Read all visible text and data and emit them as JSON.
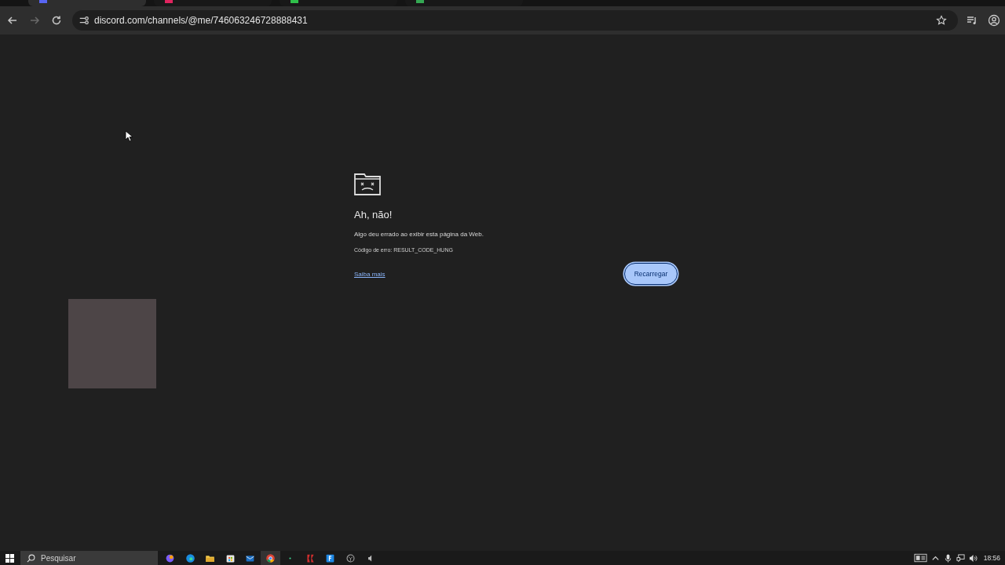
{
  "browser": {
    "tabs": [
      {
        "selected": true,
        "color": "#5865f2"
      },
      {
        "selected": false,
        "color": "#e0245e"
      },
      {
        "selected": false,
        "color": "#2fbf4a"
      },
      {
        "selected": false,
        "color": "#34a853"
      }
    ],
    "address": "discord.com/channels/@me/746063246728888431"
  },
  "error_page": {
    "heading": "Ah, não!",
    "message": "Algo deu errado ao exibir esta página da Web.",
    "code": "Código de erro: RESULT_CODE_HUNG",
    "link": "Saiba mais",
    "button": "Recarregar"
  },
  "taskbar": {
    "search": {
      "placeholder": "Pesquisar"
    },
    "apps": [
      {
        "kind": "copilot",
        "selected": false
      },
      {
        "kind": "edge",
        "selected": false
      },
      {
        "kind": "folder",
        "selected": false
      },
      {
        "kind": "store",
        "selected": false
      },
      {
        "kind": "mail",
        "selected": false
      },
      {
        "kind": "chrome",
        "selected": true
      },
      {
        "kind": "dot",
        "selected": false
      },
      {
        "kind": "red",
        "selected": false
      },
      {
        "kind": "blue",
        "selected": false
      },
      {
        "kind": "circle",
        "selected": false
      },
      {
        "kind": "speaker",
        "selected": false
      }
    ],
    "time": "18:56"
  }
}
